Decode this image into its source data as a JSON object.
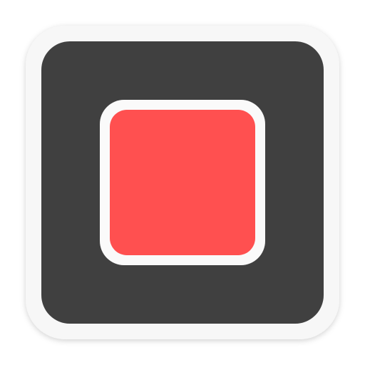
{
  "icon": {
    "name": "flat-square-app-icon",
    "colors": {
      "outer_frame": "#f7f7f7",
      "inner_tile": "#404040",
      "red_square_border": "#fafafa",
      "red_square_fill": "#ff5050"
    }
  }
}
